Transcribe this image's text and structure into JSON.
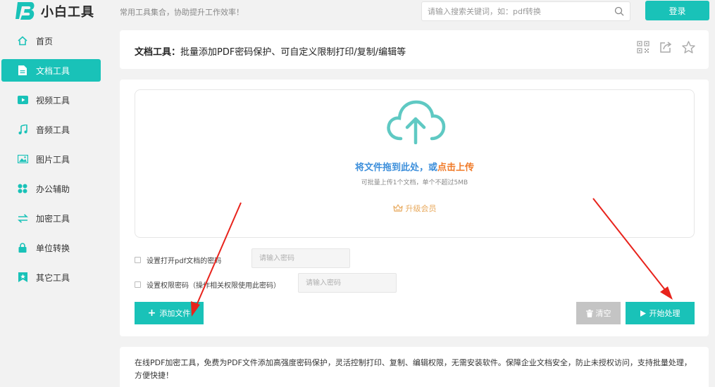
{
  "brand": {
    "name": "小白工具",
    "slogan": "常用工具集合，协助提升工作效率！"
  },
  "search": {
    "placeholder": "请输入搜索关键词，如：pdf转换"
  },
  "header": {
    "login_label": "登录"
  },
  "sidebar": {
    "items": [
      {
        "label": "首页",
        "icon": "home-icon"
      },
      {
        "label": "文档工具",
        "icon": "document-icon",
        "active": true
      },
      {
        "label": "视频工具",
        "icon": "video-icon"
      },
      {
        "label": "音频工具",
        "icon": "music-icon"
      },
      {
        "label": "图片工具",
        "icon": "image-icon"
      },
      {
        "label": "办公辅助",
        "icon": "grid-icon"
      },
      {
        "label": "加密工具",
        "icon": "swap-icon"
      },
      {
        "label": "单位转换",
        "icon": "lock-icon"
      },
      {
        "label": "其它工具",
        "icon": "star-badge-icon"
      }
    ]
  },
  "page": {
    "title_prefix": "文档工具：",
    "title": "批量添加PDF密码保护、可自定义限制打印/复制/编辑等"
  },
  "upload": {
    "drop_text_blue": "将文件拖到此处，或",
    "drop_text_orange": "点击上传",
    "limit_text": "可批量上传1个文档，单个不超过5MB",
    "upgrade_label": "升级会员"
  },
  "options": {
    "open_password_label": "设置打开pdf文档的密码",
    "open_password_placeholder": "请输入密码",
    "permission_password_label": "设置权限密码（操作相关权限使用此密码）",
    "permission_password_placeholder": "请输入密码"
  },
  "actions": {
    "add_file_label": "添加文件",
    "clear_label": "清空",
    "start_label": "开始处理"
  },
  "description": "在线PDF加密工具，免费为PDF文件添加高强度密码保护，灵活控制打印、复制、编辑权限，无需安装软件。保障企业文档安全，防止未授权访问，支持批量处理，方便快捷！",
  "colors": {
    "accent": "#19c2b8",
    "link_blue": "#3d8fdb",
    "link_orange": "#f07a28",
    "annotation_red": "#e8231c"
  }
}
